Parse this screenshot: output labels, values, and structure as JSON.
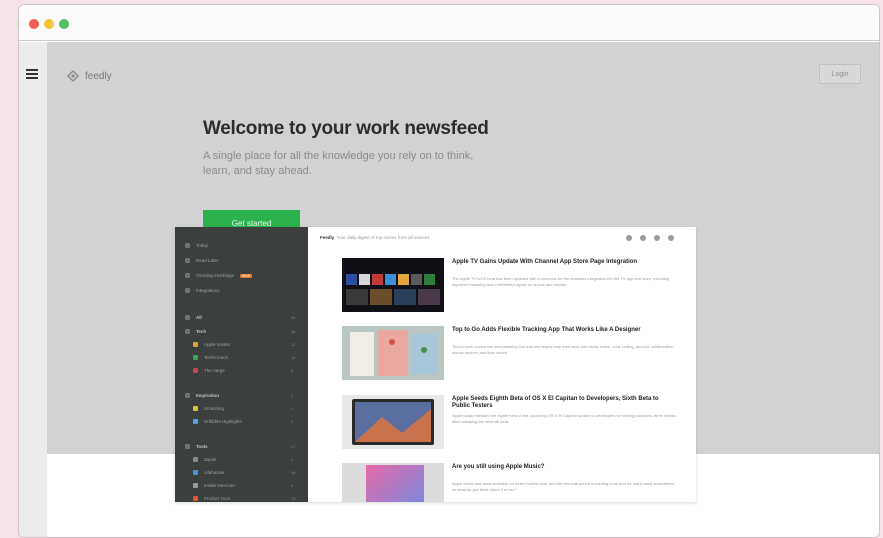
{
  "brand": {
    "name": "feedly"
  },
  "header": {
    "login_label": "Login"
  },
  "hero": {
    "title": "Welcome to your work newsfeed",
    "subtitle": "A single place for all the knowledge you rely on to think, learn, and stay ahead.",
    "cta_label": "Get started"
  },
  "colors": {
    "cta": "#2bb24c",
    "hero_bg": "#d2d2d2",
    "preview_sidebar": "#3b3f3d"
  },
  "preview": {
    "top_bar": {
      "crumb_bold": "Feedly",
      "crumb_rest": "Your daily digest of top stories from all sources"
    },
    "sidebar": {
      "top_items": [
        {
          "label": "Today",
          "icon": "sun-icon"
        },
        {
          "label": "Read Later",
          "icon": "bookmark-icon"
        },
        {
          "label": "Trending Hashtags",
          "icon": "hash-icon",
          "badge": "NEW"
        },
        {
          "label": "Integrations",
          "icon": "plug-icon"
        }
      ],
      "all_label": "All",
      "all_count": "84",
      "groups": [
        {
          "label": "Tech",
          "count": "34",
          "items": [
            {
              "label": "Apple Insider",
              "count": "12"
            },
            {
              "label": "TechCrunch",
              "count": "14"
            },
            {
              "label": "The Verge",
              "count": "8"
            }
          ]
        },
        {
          "label": "Inspiration",
          "count": "3",
          "items": [
            {
              "label": "Smashing",
              "count": "1"
            },
            {
              "label": "Dribbble Highlights",
              "count": "2"
            }
          ]
        },
        {
          "label": "Tools",
          "count": "47",
          "items": [
            {
              "label": "Zapier",
              "count": "4"
            },
            {
              "label": "Lifehacker",
              "count": "16"
            },
            {
              "label": "Inside Intercom",
              "count": "9"
            },
            {
              "label": "Product Hunt",
              "count": "18"
            }
          ]
        }
      ]
    },
    "articles": [
      {
        "title": "Apple TV Gains Update With Channel App Store Page Integration",
        "body": "The Apple TV tvOS beta has been updated with a new look for the channels integrated into the TV app and store, including improved browsing and a refreshed layout for shows and movies."
      },
      {
        "title": "Top to Go Adds Flexible Tracking App That Works Like A Designer",
        "body": "TechCrunch covers the new planning tool that lets teams map their work with sticky notes, color coding, and live collaboration across devices and time zones."
      },
      {
        "title": "Apple Seeds Eighth Beta of OS X El Capitan to Developers, Sixth Beta to Public Testers",
        "body": "Apple today released the eighth beta of the upcoming OS X El Capitan update to developers for testing purposes, three weeks after releasing the seventh beta."
      },
      {
        "title": "Are you still using Apple Music?",
        "body": "Apple Music has been available for three months now, and the free trial period is coming to an end for many early subscribers, so what do you think about it so far?"
      }
    ]
  }
}
